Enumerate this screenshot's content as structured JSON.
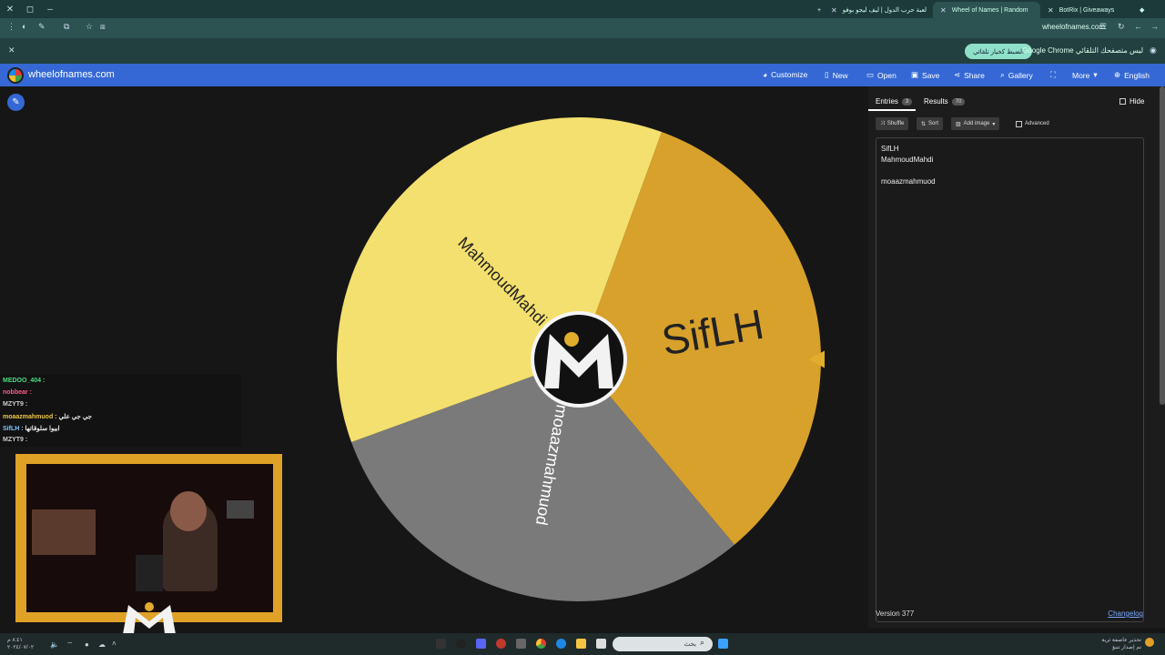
{
  "browser": {
    "tabs": [
      {
        "title": "لعبة حرب الدول | ليف ليجو بوفو",
        "active": false
      },
      {
        "title": "Wheel of Names | Random",
        "active": true
      },
      {
        "title": "BotRix | Giveaways",
        "active": false
      }
    ],
    "url": "wheelofnames.com",
    "infobar_message": "Google Chrome ليس متصفحك التلقائي",
    "infobar_button": "الضبط كخيار تلقائي"
  },
  "site": {
    "name": "wheelofnames.com",
    "nav": [
      {
        "label": "Customize",
        "icon": "palette-icon"
      },
      {
        "label": "New",
        "icon": "file-icon"
      },
      {
        "label": "Open",
        "icon": "folder-icon"
      },
      {
        "label": "Save",
        "icon": "save-icon"
      },
      {
        "label": "Share",
        "icon": "share-icon"
      },
      {
        "label": "Gallery",
        "icon": "search-icon"
      },
      {
        "label": "",
        "icon": "fullscreen-icon"
      },
      {
        "label": "More",
        "icon": "chevron-down-icon"
      },
      {
        "label": "English",
        "icon": "globe-icon"
      }
    ]
  },
  "wheel": {
    "segments": [
      {
        "label": "SifLH",
        "color": "#d8a12b"
      },
      {
        "label": "moaazmahmuod",
        "color": "#7a7a7a"
      },
      {
        "label": "MahmoudMahdi",
        "color": "#f3e06e"
      }
    ],
    "pointer_color": "#e0ad2c"
  },
  "panel": {
    "tabs": [
      {
        "label": "Entries",
        "count": "3"
      },
      {
        "label": "Results",
        "count": "70"
      }
    ],
    "hide_label": "Hide",
    "tools": {
      "shuffle": "Shuffle",
      "sort": "Sort",
      "add_image": "Add image",
      "advanced": "Advanced"
    },
    "entries": [
      "SifLH",
      "MahmoudMahdi",
      "",
      "moaazmahmuod"
    ],
    "version": "Version 377",
    "changelog": "Changelog"
  },
  "chat": [
    {
      "user": "MEDOO_404",
      "msg": "",
      "color": "#4ade80"
    },
    {
      "user": "nobbear",
      "msg": "",
      "color": "#ff5c8a"
    },
    {
      "user": "MZYT9",
      "msg": "",
      "color": "#cccccc"
    },
    {
      "user": "moaazmahmuod",
      "msg": "جي جي علي",
      "color": "#f0c64a"
    },
    {
      "user": "SifLH",
      "msg": "ابيوا سلوقاتها",
      "color": "#7ec8ff"
    },
    {
      "user": "MZYT9",
      "msg": "",
      "color": "#cccccc"
    }
  ],
  "taskbar": {
    "search_placeholder": "بحث",
    "tray_text_1": "تحذير عاصفة ثرية",
    "tray_text_2": "تم إصدار تنبؤ",
    "clock_time": "٨:٤١ م",
    "clock_date": "٢٠٢٤/٠٧/٠٢"
  }
}
